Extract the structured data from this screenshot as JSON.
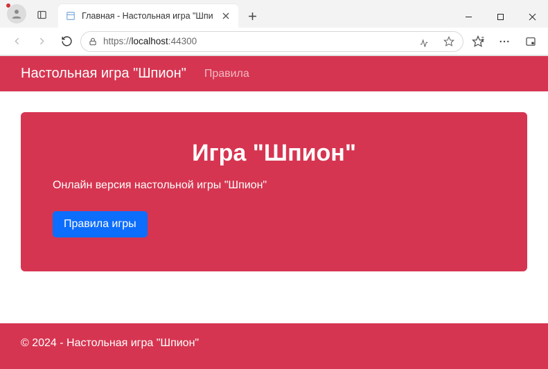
{
  "browser": {
    "tab_title": "Главная - Настольная игра \"Шпи",
    "url_scheme": "https://",
    "url_host": "localhost",
    "url_port": ":44300"
  },
  "header": {
    "brand": "Настольная игра \"Шпион\"",
    "nav_rules": "Правила"
  },
  "jumbotron": {
    "title": "Игра \"Шпион\"",
    "lead": "Онлайн версия настольной игры \"Шпион\"",
    "button": "Правила игры"
  },
  "footer": {
    "text": "© 2024 - Настольная игра \"Шпион\""
  }
}
